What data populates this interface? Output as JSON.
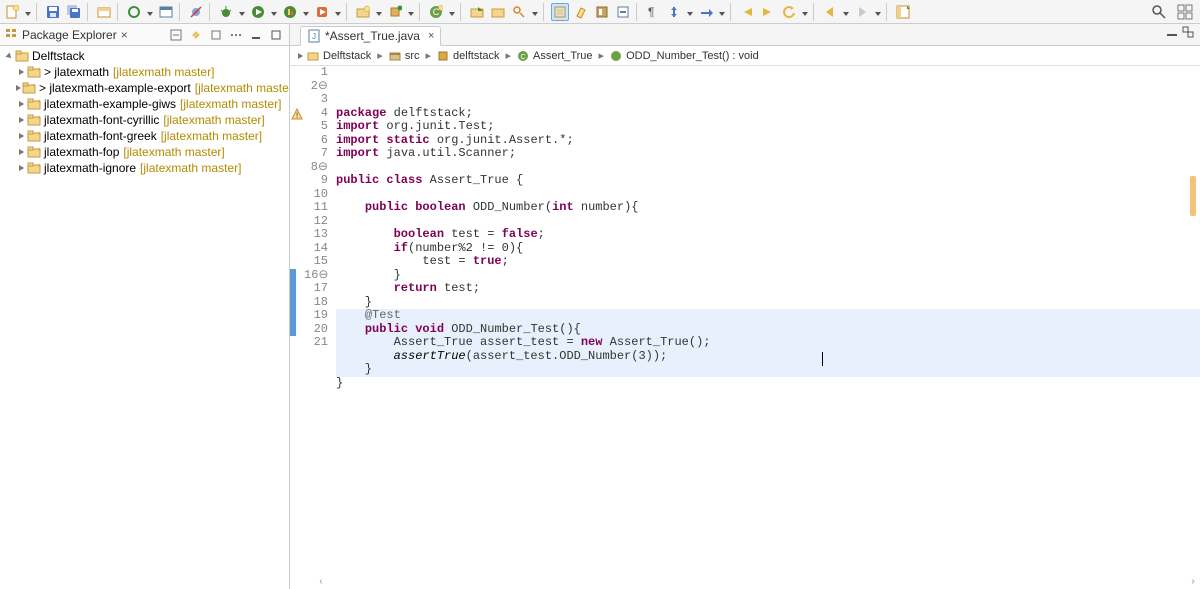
{
  "toolbar": {
    "buttons": [
      "new",
      "save",
      "save-all",
      "print",
      "new-class",
      "toggle",
      "terminal",
      "skip",
      "debug",
      "run",
      "coverage",
      "run-ext",
      "ext-tools",
      "run-gen",
      "new-pkg",
      "open-type",
      "open-task",
      "search",
      "toggle-mark",
      "toggle-block",
      "toggle-ws",
      "word-wrap",
      "show-ws",
      "pin",
      "next-ann",
      "prev-ann",
      "last-edit",
      "back",
      "fwd",
      "perspective"
    ]
  },
  "packageExplorer": {
    "title": "Package Explorer",
    "root": "Delftstack",
    "items": [
      {
        "label": "> jlatexmath",
        "decor": "[jlatexmath master]"
      },
      {
        "label": "> jlatexmath-example-export",
        "decor": "[jlatexmath master]"
      },
      {
        "label": "jlatexmath-example-giws",
        "decor": "[jlatexmath master]"
      },
      {
        "label": "jlatexmath-font-cyrillic",
        "decor": "[jlatexmath master]"
      },
      {
        "label": "jlatexmath-font-greek",
        "decor": "[jlatexmath master]"
      },
      {
        "label": "jlatexmath-fop",
        "decor": "[jlatexmath master]"
      },
      {
        "label": "jlatexmath-ignore",
        "decor": "[jlatexmath master]"
      }
    ]
  },
  "editor": {
    "tab_label": "*Assert_True.java",
    "breadcrumb": [
      "Delftstack",
      "src",
      "delftstack",
      "Assert_True",
      "ODD_Number_Test() : void"
    ],
    "lines": [
      {
        "n": "1",
        "html": "<span class='kw'>package</span> delftstack;"
      },
      {
        "n": "2",
        "marker": "fold",
        "html": "<span class='kw'>import</span> org.junit.Test;"
      },
      {
        "n": "3",
        "html": "<span class='kw'>import static</span> org.junit.Assert.*;"
      },
      {
        "n": "4",
        "marker": "warn",
        "html": "<span class='kw'>import</span> java.util.Scanner;"
      },
      {
        "n": "5",
        "html": ""
      },
      {
        "n": "6",
        "html": "<span class='kw'>public class</span> Assert_True {"
      },
      {
        "n": "7",
        "html": ""
      },
      {
        "n": "8",
        "marker": "fold",
        "html": "    <span class='kw'>public boolean</span> ODD_Number(<span class='kw'>int</span> number){"
      },
      {
        "n": "9",
        "html": ""
      },
      {
        "n": "10",
        "html": "        <span class='kw'>boolean</span> test = <span class='kw'>false</span>;"
      },
      {
        "n": "11",
        "html": "        <span class='kw'>if</span>(number%2 != 0){"
      },
      {
        "n": "12",
        "html": "            test = <span class='kw'>true</span>;"
      },
      {
        "n": "13",
        "html": "        }"
      },
      {
        "n": "14",
        "html": "        <span class='kw'>return</span> test;"
      },
      {
        "n": "15",
        "html": "    }"
      },
      {
        "n": "16",
        "marker": "fold",
        "hl": true,
        "html": "    <span class='ann'>@Test</span>"
      },
      {
        "n": "17",
        "hl": true,
        "cursor": true,
        "html": "    <span class='kw'>public void</span> ODD_Number_Test(){"
      },
      {
        "n": "18",
        "hl": true,
        "html": "        Assert_True assert_test = <span class='kw'>new</span> Assert_True();"
      },
      {
        "n": "19",
        "hl": true,
        "html": "        <span class='fn'>assertTrue</span>(assert_test.ODD_Number(3));"
      },
      {
        "n": "20",
        "hl": true,
        "html": "    }"
      },
      {
        "n": "21",
        "html": "}"
      }
    ]
  }
}
